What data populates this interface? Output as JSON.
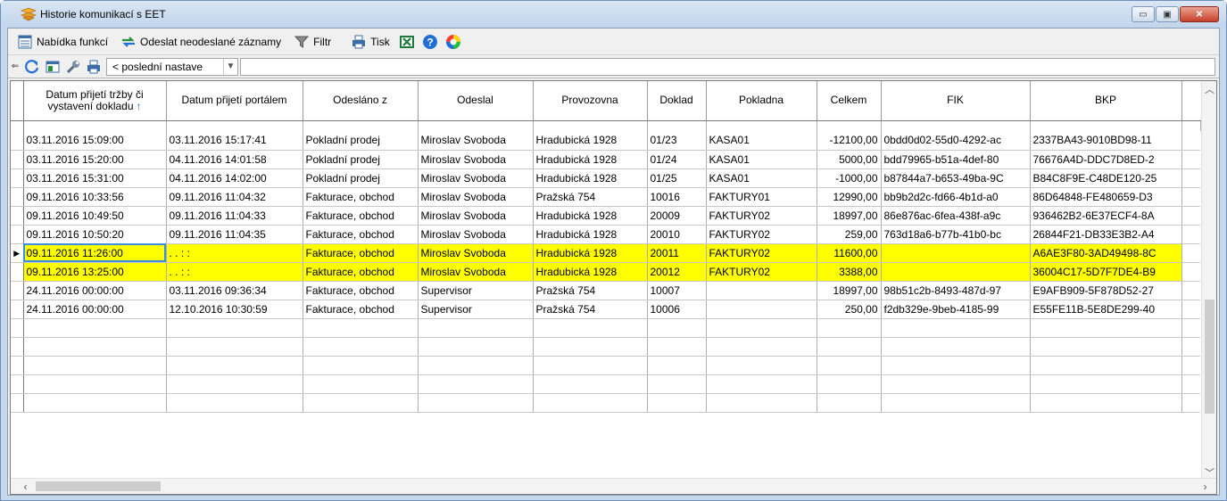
{
  "window": {
    "title": "Historie komunikací s EET",
    "minimize_label": "▭",
    "maximize_label": "▣",
    "close_label": "✕"
  },
  "toolbar": {
    "menu_label": "Nabídka funkcí",
    "send_label": "Odeslat neodeslané záznamy",
    "filter_label": "Filtr",
    "print_label": "Tisk"
  },
  "toolbar2": {
    "preset_value": "< poslední nastave"
  },
  "colors": {
    "highlight": "#ffff00",
    "selection": "#3b8fe0",
    "accent": "#1f6fd6"
  },
  "table": {
    "columns": [
      "Datum přijetí tržby či vystavení dokladu",
      "Datum přijetí portálem",
      "Odesláno z",
      "Odeslal",
      "Provozovna",
      "Doklad",
      "Pokladna",
      "Celkem",
      "FIK",
      "BKP"
    ],
    "sort_indicator": "↑",
    "rows": [
      [
        "03.11.2016 15:09:00",
        "03.11.2016 15:17:41",
        "Pokladní prodej",
        "Miroslav Svoboda",
        "Hradubická 1928",
        "01/23",
        "KASA01",
        "-12100,00",
        "0bdd0d02-55d0-4292-ac",
        "2337BA43-9010BD98-11"
      ],
      [
        "03.11.2016 15:20:00",
        "04.11.2016 14:01:58",
        "Pokladní prodej",
        "Miroslav Svoboda",
        "Hradubická 1928",
        "01/24",
        "KASA01",
        "5000,00",
        "bdd79965-b51a-4def-80",
        "76676A4D-DDC7D8ED-2"
      ],
      [
        "03.11.2016 15:31:00",
        "04.11.2016 14:02:00",
        "Pokladní prodej",
        "Miroslav Svoboda",
        "Hradubická 1928",
        "01/25",
        "KASA01",
        "-1000,00",
        "b87844a7-b653-49ba-9C",
        "B84C8F9E-C48DE120-25"
      ],
      [
        "09.11.2016 10:33:56",
        "09.11.2016 11:04:32",
        "Fakturace, obchod",
        "Miroslav Svoboda",
        "Pražská 754",
        "10016",
        "FAKTURY01",
        "12990,00",
        "bb9b2d2c-fd66-4b1d-a0",
        "86D64848-FE480659-D3"
      ],
      [
        "09.11.2016 10:49:50",
        "09.11.2016 11:04:33",
        "Fakturace, obchod",
        "Miroslav Svoboda",
        "Hradubická 1928",
        "20009",
        "FAKTURY02",
        "18997,00",
        "86e876ac-6fea-438f-a9c",
        "936462B2-6E37ECF4-8A"
      ],
      [
        "09.11.2016 10:50:20",
        "09.11.2016 11:04:35",
        "Fakturace, obchod",
        "Miroslav Svoboda",
        "Hradubická 1928",
        "20010",
        "FAKTURY02",
        "259,00",
        "763d18a6-b77b-41b0-bc",
        "26844F21-DB33E3B2-A4"
      ],
      [
        "09.11.2016 11:26:00",
        ".  .     :  :",
        "Fakturace, obchod",
        "Miroslav Svoboda",
        "Hradubická 1928",
        "20011",
        "FAKTURY02",
        "11600,00",
        "",
        "A6AE3F80-3AD49498-8C"
      ],
      [
        "09.11.2016 13:25:00",
        ".  .     :  :",
        "Fakturace, obchod",
        "Miroslav Svoboda",
        "Hradubická 1928",
        "20012",
        "FAKTURY02",
        "3388,00",
        "",
        "36004C17-5D7F7DE4-B9"
      ],
      [
        "24.11.2016 00:00:00",
        "03.11.2016 09:36:34",
        "Fakturace, obchod",
        "Supervisor",
        "Pražská 754",
        "10007",
        "",
        "18997,00",
        "98b51c2b-8493-487d-97",
        "E9AFB909-5F878D52-27"
      ],
      [
        "24.11.2016 00:00:00",
        "12.10.2016 10:30:59",
        "Fakturace, obchod",
        "Supervisor",
        "Pražská 754",
        "10006",
        "",
        "250,00",
        "f2db329e-9beb-4185-99",
        "E55FE11B-5E8DE299-40"
      ]
    ],
    "highlighted_rows": [
      6,
      7
    ],
    "current_row": 6,
    "empty_rows": 5
  }
}
